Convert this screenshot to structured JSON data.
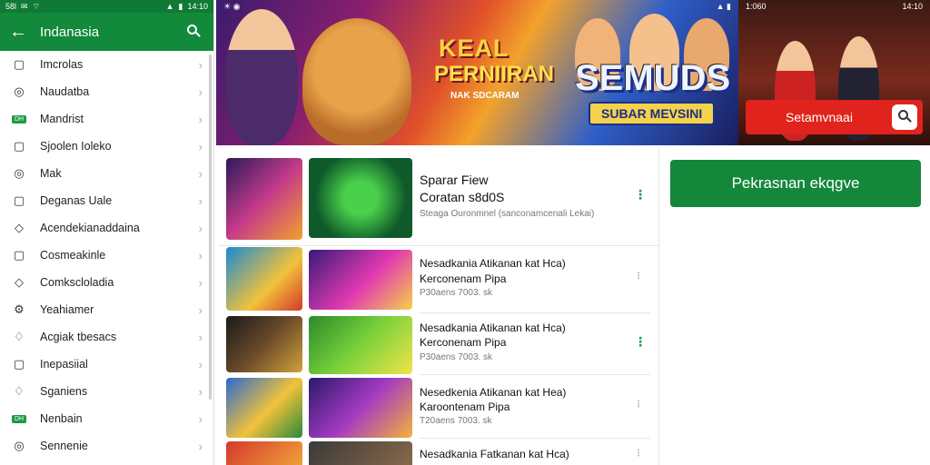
{
  "status_bar": {
    "left": "58l",
    "time": "14:10"
  },
  "app_bar": {
    "title": "Indanasia",
    "back_icon": "arrow-left-icon",
    "search_icon": "search-icon"
  },
  "menu": [
    {
      "icon": "square",
      "label": "Imcrolas"
    },
    {
      "icon": "circle",
      "label": "Naudatba"
    },
    {
      "icon": "badge",
      "badge": "DH",
      "label": "Mandrist"
    },
    {
      "icon": "square",
      "label": "Sjoolen Ioleko"
    },
    {
      "icon": "circle",
      "label": "Mak"
    },
    {
      "icon": "square",
      "label": "Deganas Uale"
    },
    {
      "icon": "tag",
      "label": "Acendekianaddaina"
    },
    {
      "icon": "square",
      "label": "Cosmeakinle"
    },
    {
      "icon": "tag",
      "label": "Comkscloladia"
    },
    {
      "icon": "gear",
      "label": "Yeahiamer"
    },
    {
      "icon": "bell",
      "label": "Acgiak tbesacs"
    },
    {
      "icon": "square",
      "label": "Inepasiial"
    },
    {
      "icon": "bell",
      "label": "Sganiens"
    },
    {
      "icon": "badge",
      "badge": "DH",
      "label": "Nenbain"
    },
    {
      "icon": "circle",
      "label": "Sennenie"
    }
  ],
  "banner": {
    "status_time": "14:10",
    "status_left": "1:060",
    "title_line1": "KEAL",
    "title_line2": "PERNIIRAN",
    "title_line3": "NAK SDCARAM",
    "title_big": "SEMUDS",
    "subtitle": "SUBAR MEVSINI",
    "search_label": "Setamvnaai"
  },
  "featured": {
    "title1": "Sparar Fiew",
    "title2": "Coratan s8d0S",
    "meta": "Steaga Ouronmnel (sanconamcenali Lekai)"
  },
  "items": [
    {
      "title": "Nesadkania Atikanan kat Hca)",
      "subtitle": "Kerconenam Pipa",
      "meta": "P30aens 7003. sk",
      "kebab_green": false
    },
    {
      "title": "Nesadkania Atikanan kat Hca)",
      "subtitle": "Kerconenam Pipa",
      "meta": "P30aens 7003. sk",
      "kebab_green": true
    },
    {
      "title": "Nesedkenia Atikanan kat Hea)",
      "subtitle": "Karoontenam Pipa",
      "meta": "T20aens 7003. sk",
      "kebab_green": false
    },
    {
      "title": "Nesadkania Fatkanan kat Hca)",
      "subtitle": "",
      "meta": "",
      "kebab_green": false
    }
  ],
  "primary_button": "Pekrasnan ekqgve",
  "colors": {
    "brand_green": "#12893b",
    "accent_red": "#e0231c"
  }
}
